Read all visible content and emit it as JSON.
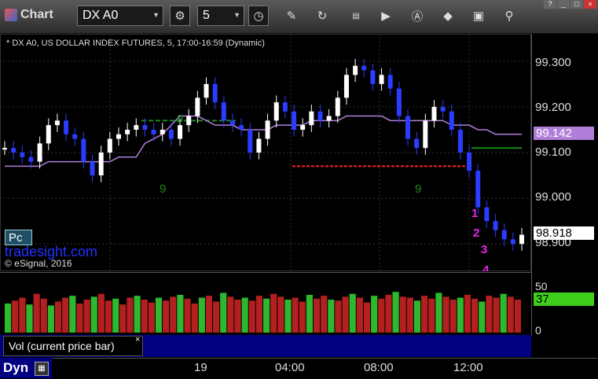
{
  "app": {
    "title": "Chart",
    "symbol": "DX A0",
    "interval": "5"
  },
  "toolbar": {
    "icons": [
      "gear-icon",
      "clock-icon",
      "pencil-icon",
      "refresh-icon",
      "ge-icon",
      "play-icon",
      "alert-icon",
      "diamond-icon",
      "camera-icon",
      "pin-icon"
    ]
  },
  "window": {
    "help": "?",
    "minimize": "_",
    "maximize": "□",
    "close": "×"
  },
  "chart": {
    "title": "* DX A0, US DOLLAR INDEX FUTURES, 5, 17:00-16:59 (Dynamic)",
    "pc_label": "Pc",
    "watermark": "tradesight.com",
    "copyright": "© eSignal, 2016",
    "ma_tag": "99.142",
    "price_tag": "98.918",
    "colors": {
      "up": "#ffffff",
      "down": "#2a3cff",
      "ma": "#b07ed8",
      "setup": "#1a8a1a",
      "count": "#ee22ee",
      "stop": "#ff2222"
    }
  },
  "chart_data": {
    "type": "line",
    "yticks": [
      "99.300",
      "99.200",
      "99.100",
      "99.000",
      "98.900"
    ],
    "ylim": [
      98.84,
      99.36
    ],
    "xlabels": [
      "19",
      "04:00",
      "08:00",
      "12:00"
    ],
    "price": [
      99.11,
      99.1,
      99.09,
      99.08,
      99.12,
      99.16,
      99.17,
      99.14,
      99.13,
      99.08,
      99.05,
      99.1,
      99.13,
      99.14,
      99.15,
      99.16,
      99.15,
      99.14,
      99.15,
      99.13,
      99.16,
      99.18,
      99.22,
      99.25,
      99.21,
      99.17,
      99.16,
      99.15,
      99.1,
      99.13,
      99.17,
      99.21,
      99.19,
      99.15,
      99.16,
      99.19,
      99.17,
      99.18,
      99.22,
      99.27,
      99.29,
      99.28,
      99.25,
      99.27,
      99.24,
      99.18,
      99.13,
      99.11,
      99.17,
      99.2,
      99.19,
      99.15,
      99.1,
      99.06,
      98.98,
      98.95,
      98.93,
      98.91,
      98.9,
      98.92
    ],
    "ma": [
      99.07,
      99.07,
      99.07,
      99.07,
      99.07,
      99.08,
      99.08,
      99.08,
      99.08,
      99.08,
      99.08,
      99.08,
      99.08,
      99.09,
      99.09,
      99.09,
      99.12,
      99.13,
      99.14,
      99.16,
      99.18,
      99.18,
      99.18,
      99.17,
      99.16,
      99.16,
      99.16,
      99.15,
      99.15,
      99.15,
      99.15,
      99.16,
      99.16,
      99.16,
      99.16,
      99.17,
      99.17,
      99.17,
      99.17,
      99.18,
      99.18,
      99.18,
      99.18,
      99.18,
      99.17,
      99.17,
      99.17,
      99.17,
      99.17,
      99.17,
      99.17,
      99.16,
      99.16,
      99.16,
      99.15,
      99.15,
      99.14,
      99.14,
      99.14,
      99.14
    ],
    "labels": [
      {
        "text": "9",
        "kind": "setup"
      },
      {
        "text": "9",
        "kind": "setup"
      },
      {
        "text": "9",
        "kind": "setup"
      },
      {
        "text": "1",
        "kind": "count"
      },
      {
        "text": "2",
        "kind": "count"
      },
      {
        "text": "3",
        "kind": "count"
      },
      {
        "text": "4",
        "kind": "count"
      }
    ],
    "volume": {
      "yticks": [
        "50",
        "0"
      ],
      "level_tag": "37",
      "max": 60,
      "bars": [
        30,
        33,
        36,
        29,
        40,
        35,
        28,
        32,
        36,
        38,
        30,
        34,
        37,
        40,
        33,
        35,
        29,
        36,
        38,
        34,
        31,
        36,
        33,
        37,
        39,
        35,
        30,
        36,
        38,
        32,
        41,
        37,
        34,
        36,
        33,
        38,
        35,
        40,
        37,
        34,
        36,
        32,
        39,
        35,
        38,
        34,
        33,
        37,
        40,
        36,
        31,
        38,
        35,
        39,
        42,
        37,
        36,
        33,
        38,
        35,
        41,
        37,
        34,
        36,
        39,
        35,
        32,
        38,
        36,
        40,
        37,
        34
      ]
    },
    "volume_label": "Vol (current price bar)"
  },
  "footer": {
    "mode": "Dyn"
  }
}
